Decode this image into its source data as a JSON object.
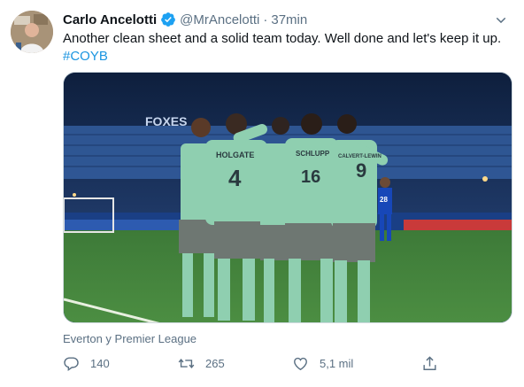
{
  "tweet": {
    "author_name": "Carlo Ancelotti",
    "handle": "@MrAncelotti",
    "separator": "·",
    "time": "37min",
    "text": "Another clean sheet and a solid team today. Well done and let's keep it up.",
    "hashtag": "#COYB",
    "media_caption": "Everton y Premier League",
    "replies": "140",
    "retweets": "265",
    "likes": "5,1 mil"
  },
  "photo": {
    "stadium_board": "FOXES",
    "player_names": [
      "HOLGATE",
      "SCHLUPP",
      "CALVERT-LEWIN",
      "28"
    ],
    "player_numbers": [
      "4",
      "16",
      "9"
    ]
  },
  "icons": {
    "verified": "verified-badge-icon",
    "more": "more-options-icon",
    "reply": "reply-icon",
    "retweet": "retweet-icon",
    "like": "heart-icon",
    "share": "share-icon"
  },
  "colors": {
    "accent": "#1b95e0",
    "muted": "#5b7083",
    "kit": "#8fcfb0",
    "pitch": "#3f7d3a"
  }
}
